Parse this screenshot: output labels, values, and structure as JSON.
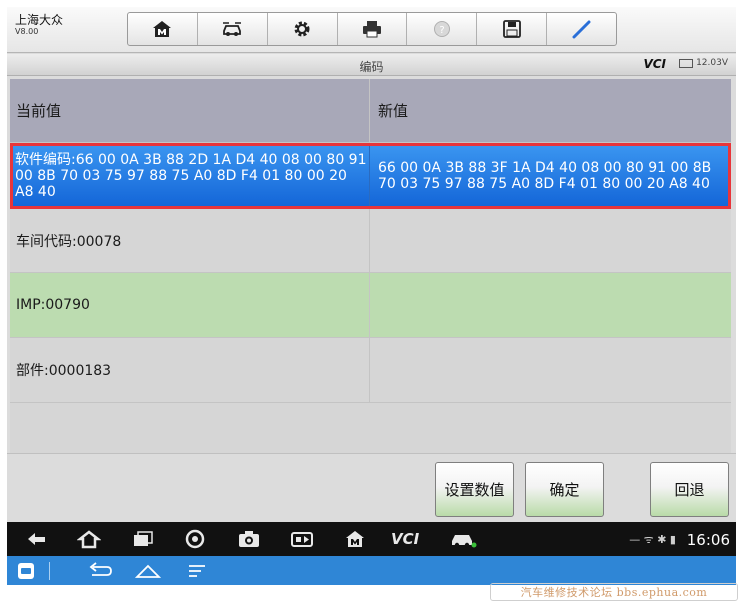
{
  "brand": {
    "name": "上海大众",
    "version": "V8.00"
  },
  "toolbar": {
    "icons": [
      "home-icon",
      "car-icon",
      "gear-icon",
      "printer-icon",
      "help-icon",
      "save-icon",
      "pen-icon"
    ]
  },
  "titlebar": {
    "title": "编码",
    "vci": "VCI",
    "battery": "12.03V"
  },
  "table": {
    "headers": {
      "current": "当前值",
      "new": "新值"
    },
    "rows": [
      {
        "current": "软件编码:66 00 0A 3B 88 2D 1A D4 40 08 00 80 91 00 8B 70 03 75 97 88 75 A0 8D F4 01 80 00 20 A8 40",
        "new": "66 00 0A 3B 88 3F 1A D4 40 08 00 80 91 00 8B 70 03 75 97 88 75 A0 8D F4 01 80 00 20 A8 40"
      },
      {
        "current": "车间代码:00078",
        "new": ""
      },
      {
        "current": "IMP:00790",
        "new": ""
      },
      {
        "current": "部件:0000183",
        "new": ""
      }
    ]
  },
  "actions": {
    "set_value": "设置数值",
    "confirm": "确定",
    "back": "回退"
  },
  "navbar": {
    "vci": "VCI",
    "time": "16:06"
  },
  "watermark": "汽车维修技术论坛 bbs.ephua.com",
  "colors": {
    "selected_row": "#1e7ae4",
    "selected_border": "#e8353a",
    "header_row": "#a8a8b8",
    "green_row": "#bcdcb0"
  }
}
